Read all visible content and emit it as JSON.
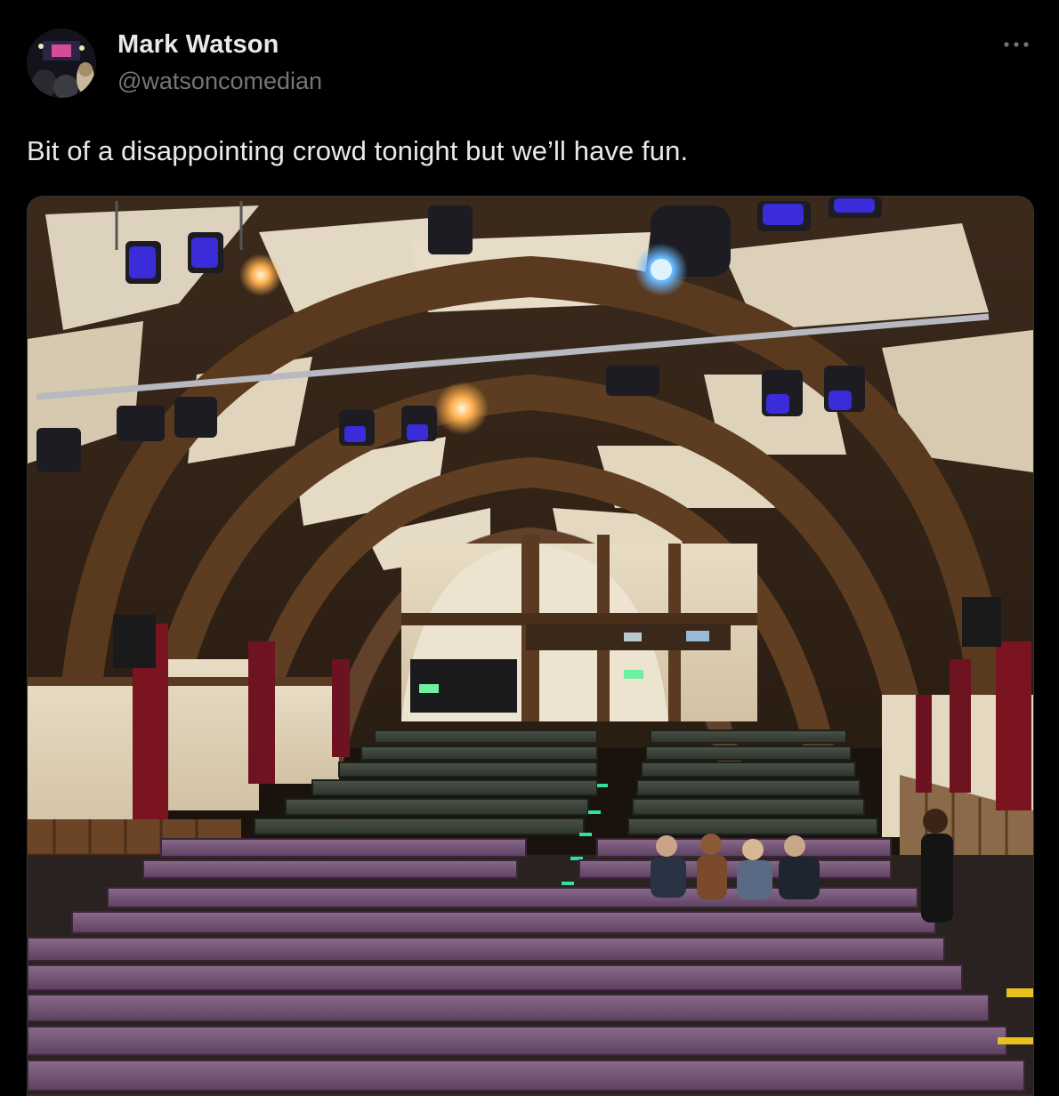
{
  "author": {
    "name": "Mark Watson",
    "handle": "@watsoncomedian",
    "avatar_icon": "avatar-photo"
  },
  "more_icon": "more-dots-icon",
  "tweet": {
    "text": "Bit of a disappointing crowd tonight but we’ll have fun."
  },
  "photo": {
    "icon": "venue-hall-photo"
  },
  "colors": {
    "background": "#000000",
    "text_primary": "#e7e9ea",
    "text_secondary": "#71767b",
    "border": "#2f3336"
  }
}
